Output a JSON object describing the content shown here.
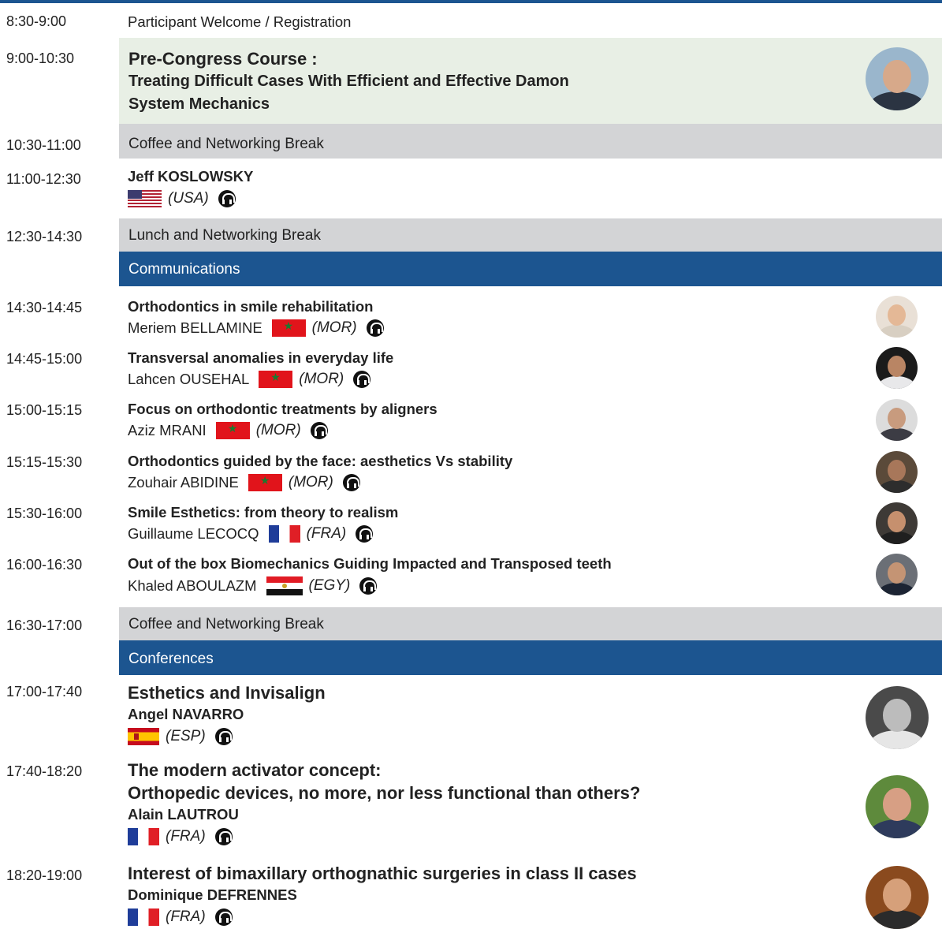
{
  "agenda": [
    {
      "time": "8:30-9:00",
      "label": "Participant Welcome / Registration"
    },
    {
      "time": "9:00-10:30",
      "title_l1": "Pre-Congress Course :",
      "title_l2": "Treating Difficult Cases With Efficient and Effective Damon",
      "title_l3": "System Mechanics"
    },
    {
      "time": "10:30-11:00",
      "label": "Coffee and Networking Break"
    },
    {
      "time": "11:00-12:30",
      "speaker": "Jeff KOSLOWSKY",
      "country": "(USA)"
    },
    {
      "time": "12:30-14:30",
      "label": "Lunch and Networking Break"
    },
    {
      "section": "Communications"
    },
    {
      "time": "14:30-14:45",
      "title": "Orthodontics in smile rehabilitation",
      "speaker": "Meriem BELLAMINE",
      "country": "(MOR)"
    },
    {
      "time": "14:45-15:00",
      "title": "Transversal anomalies in everyday life",
      "speaker": "Lahcen OUSEHAL",
      "country": "(MOR)"
    },
    {
      "time": "15:00-15:15",
      "title": "Focus on orthodontic treatments by aligners",
      "speaker": "Aziz MRANI",
      "country": "(MOR)"
    },
    {
      "time": "15:15-15:30",
      "title": "Orthodontics guided by the face: aesthetics Vs stability",
      "speaker": "Zouhair ABIDINE",
      "country": "(MOR)"
    },
    {
      "time": "15:30-16:00",
      "title": "Smile Esthetics: from theory to realism",
      "speaker": "Guillaume LECOCQ",
      "country": "(FRA)"
    },
    {
      "time": "16:00-16:30",
      "title": "Out of the box Biomechanics Guiding Impacted and Transposed teeth",
      "speaker": "Khaled ABOULAZM",
      "country": "(EGY)"
    },
    {
      "time": "16:30-17:00",
      "label": "Coffee and Networking Break"
    },
    {
      "section": "Conferences"
    },
    {
      "time": "17:00-17:40",
      "title": "Esthetics and Invisalign",
      "speaker": "Angel NAVARRO",
      "country": "(ESP)"
    },
    {
      "time": "17:40-18:20",
      "title_l1": "The modern activator concept:",
      "title_l2": "Orthopedic devices, no more, nor less functional than others?",
      "speaker": "Alain LAUTROU",
      "country": "(FRA)"
    },
    {
      "time": "18:20-19:00",
      "title": "Interest of bimaxillary orthognathic surgeries in class II cases",
      "speaker": "Dominique DEFRENNES",
      "country": "(FRA)"
    }
  ],
  "colors": {
    "brand_blue": "#1c5590",
    "break_grey": "#d3d4d6",
    "course_green": "#e8efe5"
  },
  "icons": [
    "headphones-icon",
    "flag-usa",
    "flag-morocco",
    "flag-france",
    "flag-egypt",
    "flag-spain",
    "speaker-photo"
  ]
}
